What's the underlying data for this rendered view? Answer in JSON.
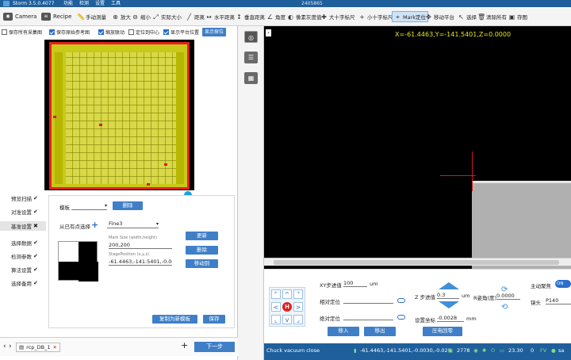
{
  "titlebar": {
    "app_title": "Storm 3.5.0.4077",
    "menus": [
      "功能",
      "检测",
      "设置",
      "工具"
    ],
    "window_title": "2405865"
  },
  "toolbar": {
    "camera": "Camera",
    "recipe": "Recipe",
    "items": [
      {
        "icon": "ruler-icon",
        "label": "手动测量"
      },
      {
        "icon": "zoom-in-icon",
        "label": "放大"
      },
      {
        "icon": "zoom-out-icon",
        "label": "缩小"
      },
      {
        "icon": "actual-size-icon",
        "label": "实际大小"
      },
      {
        "icon": "distance-icon",
        "label": "距离"
      },
      {
        "icon": "horizontal-distance-icon",
        "label": "水平距离"
      },
      {
        "icon": "vertical-distance-icon",
        "label": "垂直距离"
      },
      {
        "icon": "angle-icon",
        "label": "角度"
      },
      {
        "icon": "gray-value-icon",
        "label": "像素灰度值"
      },
      {
        "icon": "big-crosshair-icon",
        "label": "大十字标尺"
      },
      {
        "icon": "small-crosshair-icon",
        "label": "小十字标尺"
      },
      {
        "icon": "mark-locate-icon",
        "label": "Mark定位"
      },
      {
        "icon": "move-stage-icon",
        "label": "移动平台"
      },
      {
        "icon": "select-icon",
        "label": "选择"
      },
      {
        "icon": "trash-icon",
        "label": "清除所有"
      },
      {
        "icon": "save-image-icon",
        "label": "存图"
      }
    ]
  },
  "options": {
    "save_all_images": "保存所有采集图",
    "save_raw_ref": "保存原始参考图",
    "zoom_follow": "缩放联动",
    "locate_center": "定位到中心",
    "show_platform_pos": "显示平台位置",
    "show_platform_btn": "显示探位"
  },
  "steps": [
    {
      "label": "预览扫描",
      "status": "✔"
    },
    {
      "label": "对准设置",
      "status": "✔"
    },
    {
      "label": "基准设置",
      "status": "✖"
    },
    {
      "label": "选择数据",
      "status": "✔"
    },
    {
      "label": "检测参数",
      "status": "✔"
    },
    {
      "label": "算法设置",
      "status": "✔"
    },
    {
      "label": "选择备用",
      "status": "✔"
    }
  ],
  "panel": {
    "template_label": "模板",
    "template_value": "",
    "delete_btn": "删除",
    "select_from_existing": "从已有点选择",
    "mark_select": "Fine3",
    "mark_size_label": "Mark Size (width,height)",
    "mark_size_value": "200,200",
    "stage_position_label": "StagePosition (x,y,z)",
    "stage_position_value": "-61.4463,-141.5401,-0.0035",
    "update_btn": "更新",
    "delete2_btn": "删除",
    "move_to_btn": "移动到",
    "copy_template_btn": "复制为新模板",
    "save_btn": "保存"
  },
  "bottom": {
    "tab": "rcp_DB_1",
    "next": "下一步"
  },
  "viewer": {
    "coord_text": "X=-61.4463,Y=-141.5401,Z=0.0000"
  },
  "stage": {
    "xy_step_label": "XY步进值",
    "xy_step_value": "100",
    "xy_unit": "um",
    "relative_label": "相对定位",
    "absolute_label": "绝对定位",
    "move_in": "移入",
    "move_out": "移出",
    "z_step_label": "Z 步进值",
    "z_step_value": "0.3",
    "z_unit": "um",
    "set_coord_label": "设置坐标",
    "set_coord_value": "-0.0028",
    "set_coord_unit": "mm",
    "zero_btn": "压电回零",
    "r_label": "R姿角(度)",
    "r_value": "0.0000",
    "autofocus_label": "主动聚焦",
    "toggle": "ON",
    "lens_label": "镜头",
    "lens_value": "P140"
  },
  "status": {
    "message": "Chuck vacuum close",
    "position": "-61.4463,-141.5401,-0.0030,-0.029",
    "count": "2778",
    "temp": "23.30",
    "zero": "0",
    "fv": "FV",
    "user": "sa"
  }
}
